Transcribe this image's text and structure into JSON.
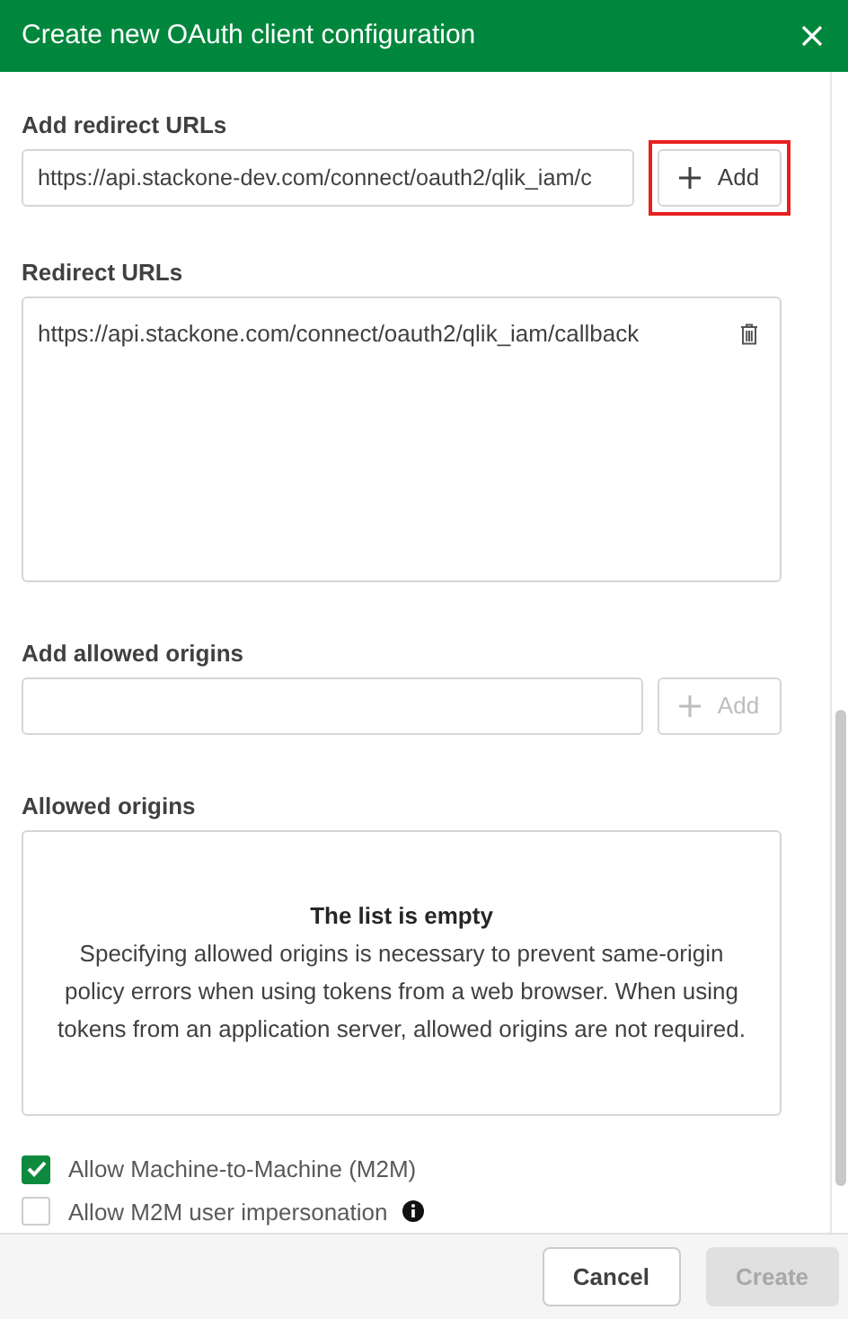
{
  "dialog": {
    "title": "Create new OAuth client configuration"
  },
  "redirect_input": {
    "label": "Add redirect URLs",
    "value": "https://api.stackone-dev.com/connect/oauth2/qlik_iam/c",
    "button": {
      "label": "Add",
      "disabled": false,
      "highlighted": true
    }
  },
  "redirect_list": {
    "label": "Redirect URLs",
    "items": [
      "https://api.stackone.com/connect/oauth2/qlik_iam/callback"
    ]
  },
  "origins_input": {
    "label": "Add allowed origins",
    "button": {
      "label": "Add",
      "disabled": true,
      "highlighted": false
    }
  },
  "origins_list": {
    "label": "Allowed origins",
    "empty_title": "The list is empty",
    "empty_text": "Specifying allowed origins is necessary to prevent same-origin policy errors when using tokens from a web browser. When using tokens from an application server, allowed origins are not required."
  },
  "options": [
    {
      "label": "Allow Machine-to-Machine (M2M)",
      "checked": true,
      "info": false
    },
    {
      "label": "Allow M2M user impersonation",
      "checked": false,
      "info": true
    }
  ],
  "footer": [
    {
      "label": "Cancel",
      "disabled": false
    },
    {
      "label": "Create",
      "disabled": true
    }
  ]
}
